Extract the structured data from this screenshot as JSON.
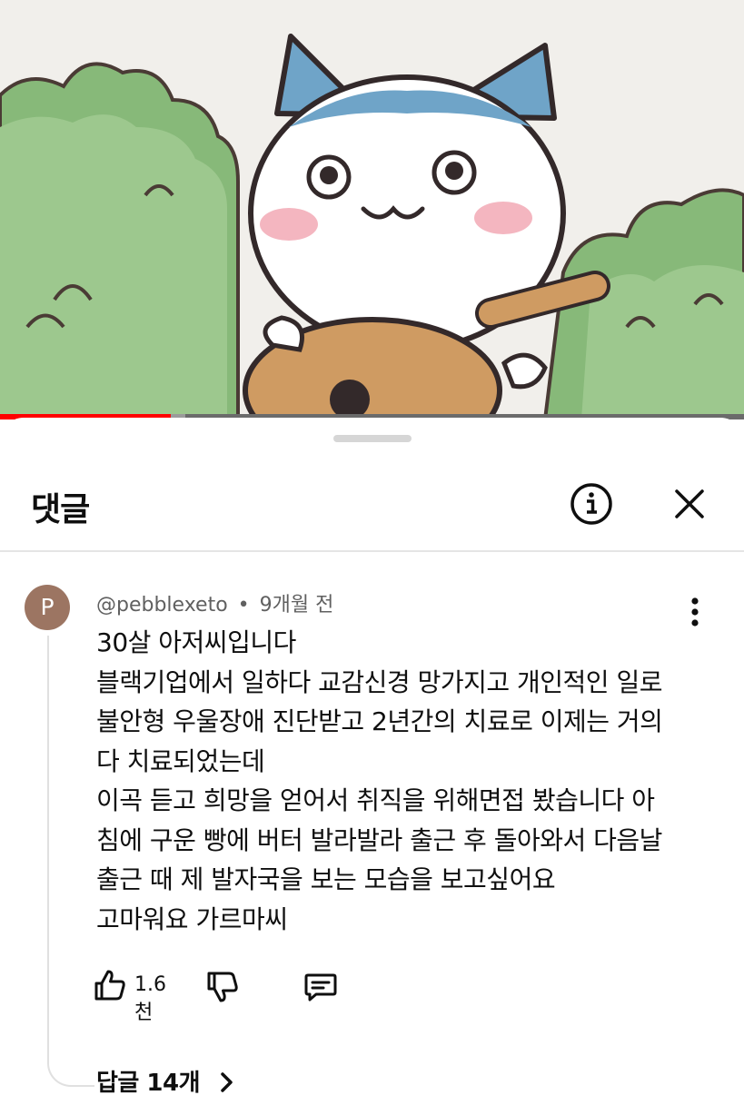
{
  "video": {
    "progress_fraction": 0.23,
    "buffered_fraction": 0.25,
    "colors": {
      "played": "#ff0000",
      "buffered": "#9b9b9b",
      "track": "#6b6b6b"
    }
  },
  "panel": {
    "title": "댓글",
    "info_icon": "info-icon",
    "close_icon": "close-icon"
  },
  "comment": {
    "avatar_letter": "P",
    "avatar_color": "#9c7562",
    "author": "@pebblexeto",
    "separator": "•",
    "time": "9개월 전",
    "lines": [
      "30살 아저씨입니다",
      "블랙기업에서 일하다 교감신경 망가지고 개인적인 일로",
      "불안형 우울장애 진단받고 2년간의 치료로 이제는 거의",
      "다 치료되었는데",
      "이곡 듣고 희망을 얻어서 취직을 위해면접 봤습니다 아",
      "침에 구운 빵에 버터 발라발라 출근 후 돌아와서 다음날",
      "출근 때 제 발자국을 보는 모습을 보고싶어요",
      "고마워요 가르마씨"
    ],
    "likes": "1.6천",
    "replies_label": "답글 14개",
    "icons": [
      "like-icon",
      "dislike-icon",
      "reply-icon",
      "more-vert-icon",
      "chevron-right-icon"
    ]
  }
}
